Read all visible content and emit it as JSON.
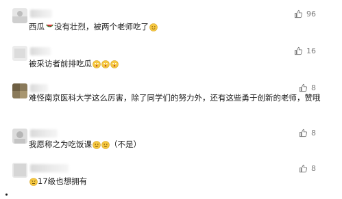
{
  "comments": [
    {
      "text_before": "西瓜",
      "text_after": "没有壮烈，被两个老师吃了",
      "likes": "96",
      "emoji": [
        "watermelon",
        "emoji-face"
      ]
    },
    {
      "text_before": "被采访者前排吃瓜",
      "text_after": "",
      "likes": "16",
      "emoji": [
        "emoji-face",
        "emoji-face",
        "emoji-face"
      ]
    },
    {
      "text_before": "难怪南京医科大学这么厉害，除了同学们的努力外，还有这些勇于创新的老师，赞哦",
      "text_after": "",
      "likes": "8",
      "emoji": []
    },
    {
      "text_before": "我愿称之为吃饭课",
      "text_after": "（不是）",
      "likes": "8",
      "emoji": [
        "emoji-face",
        "emoji-face"
      ]
    },
    {
      "text_before": "17级也想拥有",
      "text_after": "",
      "likes": "8",
      "emoji": [
        "emoji-face"
      ]
    }
  ],
  "colors": {
    "text": "#1a1a1a",
    "muted": "#7a7a7a",
    "emoji": "#f5c842"
  },
  "icons": {
    "like": "thumbs-up-icon"
  }
}
